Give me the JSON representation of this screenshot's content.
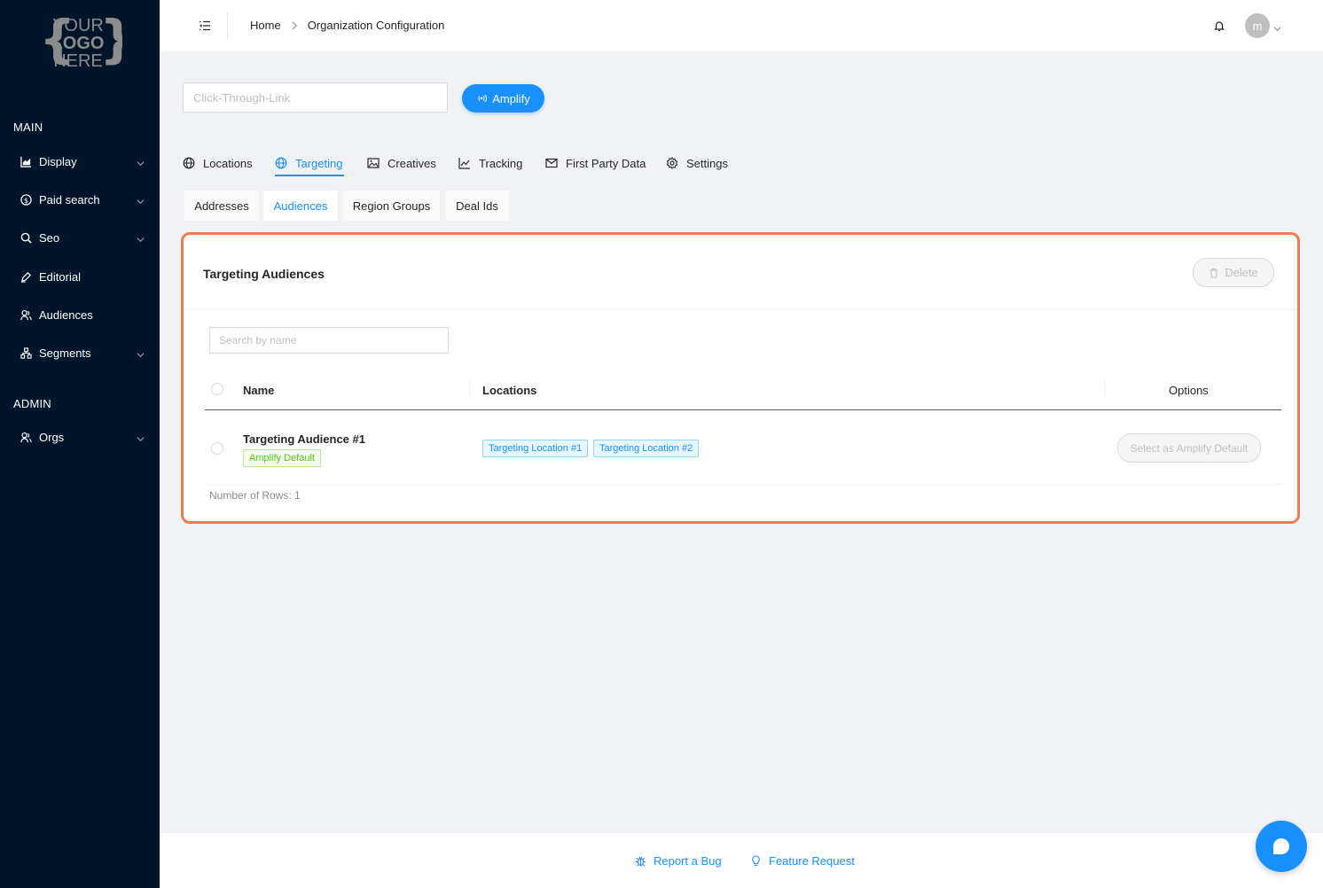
{
  "sidebar": {
    "logo": [
      "YOUR",
      "LOGO",
      "HERE"
    ],
    "main_label": "MAIN",
    "admin_label": "ADMIN",
    "items": [
      {
        "label": "Display",
        "icon": "area-chart-icon",
        "has_children": true
      },
      {
        "label": "Paid search",
        "icon": "dollar-icon",
        "has_children": true
      },
      {
        "label": "Seo",
        "icon": "search-icon",
        "has_children": true
      },
      {
        "label": "Editorial",
        "icon": "pen-icon",
        "has_children": false
      },
      {
        "label": "Audiences",
        "icon": "user-group-icon",
        "has_children": false
      },
      {
        "label": "Segments",
        "icon": "cluster-icon",
        "has_children": true
      }
    ],
    "admin_items": [
      {
        "label": "Orgs",
        "icon": "user-group-icon",
        "has_children": true
      }
    ]
  },
  "header": {
    "breadcrumb": [
      "Home",
      "Organization Configuration"
    ],
    "avatar_initial": "m"
  },
  "toolbar": {
    "link_placeholder": "Click-Through-Link",
    "amplify_label": "Amplify"
  },
  "tabs": [
    {
      "label": "Locations",
      "icon": "globe-icon"
    },
    {
      "label": "Targeting",
      "icon": "globe-icon",
      "active": true
    },
    {
      "label": "Creatives",
      "icon": "picture-icon"
    },
    {
      "label": "Tracking",
      "icon": "line-chart-icon"
    },
    {
      "label": "First Party Data",
      "icon": "mail-icon"
    },
    {
      "label": "Settings",
      "icon": "gear-icon"
    }
  ],
  "subtabs": [
    {
      "label": "Addresses"
    },
    {
      "label": "Audiences",
      "active": true
    },
    {
      "label": "Region Groups"
    },
    {
      "label": "Deal Ids"
    }
  ],
  "card": {
    "title": "Targeting Audiences",
    "delete_label": "Delete",
    "search_placeholder": "Search by name",
    "columns": [
      "Name",
      "Locations",
      "Options"
    ],
    "rows": [
      {
        "name": "Targeting Audience #1",
        "tag": "Amplify Default",
        "locations": [
          "Targeting Location #1",
          "Targeting Location #2"
        ],
        "action": "Select as Amplify Default"
      }
    ],
    "row_count": "Number of Rows: 1"
  },
  "footer": {
    "report_bug": "Report a Bug",
    "feature_request": "Feature Request"
  },
  "colors": {
    "sidebar_bg": "#001529",
    "primary": "#1890ff",
    "highlight_border": "#f47b47",
    "tag_green": "#52c41a"
  }
}
